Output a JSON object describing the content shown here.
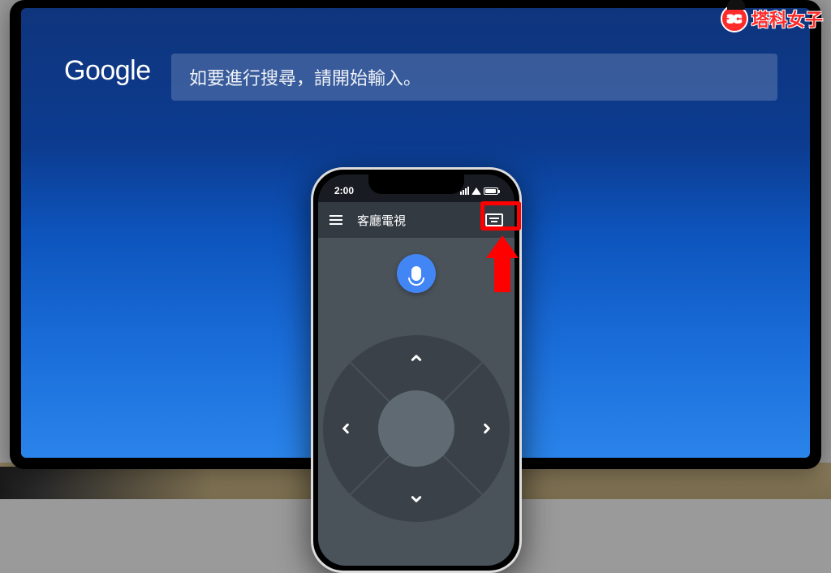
{
  "watermark": {
    "text": "塔科女子",
    "badge": "3C"
  },
  "tv": {
    "logo": "Google",
    "search_placeholder": "如要進行搜尋，請開始輸入。"
  },
  "phone": {
    "status": {
      "time": "2:00"
    },
    "app_bar": {
      "title": "客廳電視"
    },
    "icons": {
      "menu": "hamburger-icon",
      "keyboard": "keyboard-icon",
      "mic": "mic-icon"
    },
    "dpad": {
      "up": "up",
      "down": "down",
      "left": "left",
      "right": "right",
      "center": "ok"
    }
  },
  "annotation": {
    "highlight": "keyboard-button"
  }
}
